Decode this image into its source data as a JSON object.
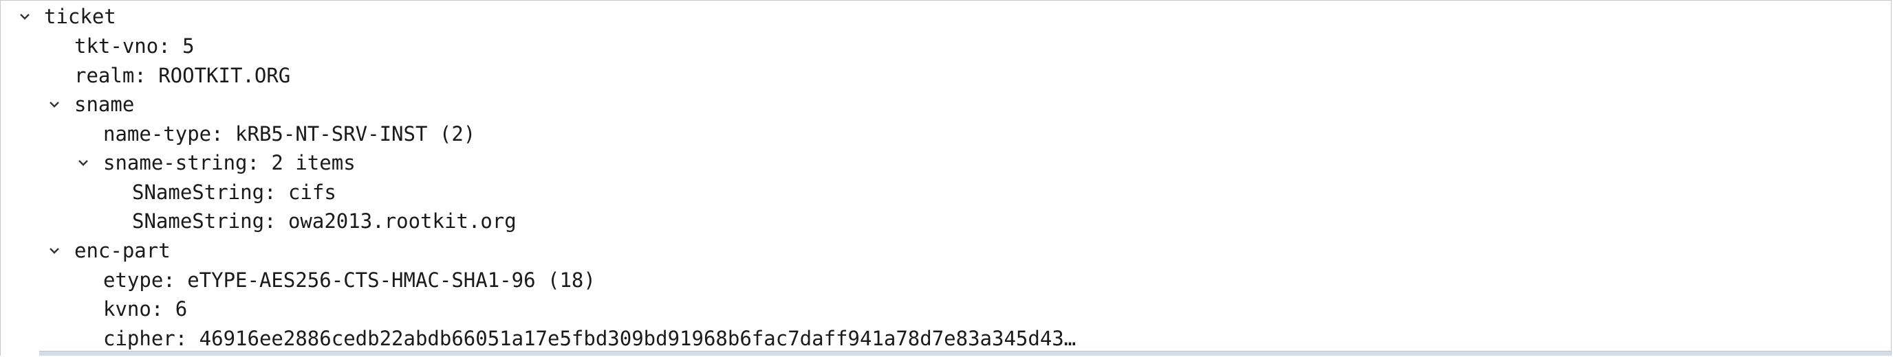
{
  "tree": {
    "ticket": {
      "label": "ticket"
    },
    "tkt_vno": {
      "label": "tkt-vno: 5"
    },
    "realm": {
      "label": "realm: ROOTKIT.ORG"
    },
    "sname": {
      "label": "sname"
    },
    "name_type": {
      "label": "name-type: kRB5-NT-SRV-INST (2)"
    },
    "sname_string": {
      "label": "sname-string: 2 items"
    },
    "sname_string_1": {
      "label": "SNameString: cifs"
    },
    "sname_string_2": {
      "label": "SNameString: owa2013.rootkit.org"
    },
    "enc_part": {
      "label": "enc-part"
    },
    "etype": {
      "label": "etype: eTYPE-AES256-CTS-HMAC-SHA1-96 (18)"
    },
    "kvno": {
      "label": "kvno: 6"
    },
    "cipher": {
      "label": "cipher: 46916ee2886cedb22abdb66051a17e5fbd309bd91968b6fac7daff941a78d7e83a345d43…"
    }
  },
  "icons": {
    "expanded": "chevron-down-icon"
  }
}
